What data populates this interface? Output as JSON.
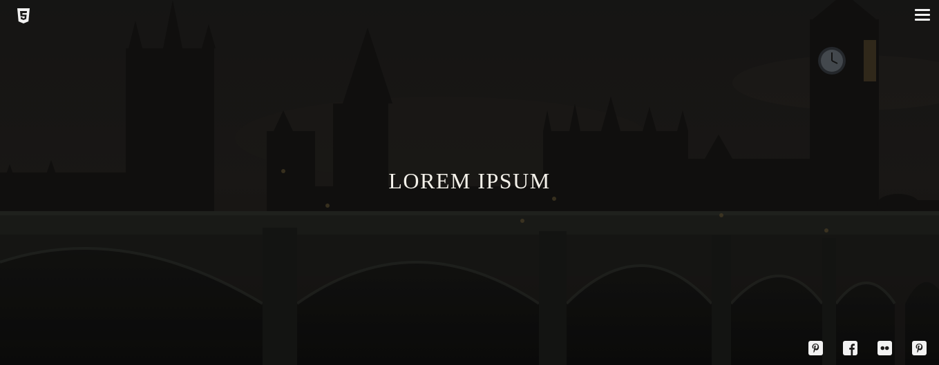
{
  "hero": {
    "headline": "LOREM IPSUM"
  },
  "header": {
    "logo_icon": "css3-shield-icon",
    "menu_icon": "hamburger-menu-icon"
  },
  "social": {
    "items": [
      {
        "icon": "pinterest-icon"
      },
      {
        "icon": "facebook-icon"
      },
      {
        "icon": "flickr-icon"
      },
      {
        "icon": "pinterest-icon"
      }
    ]
  },
  "colors": {
    "text": "#f4f1ea",
    "icon": "#f2f2f2",
    "background": "#1b1a19"
  }
}
